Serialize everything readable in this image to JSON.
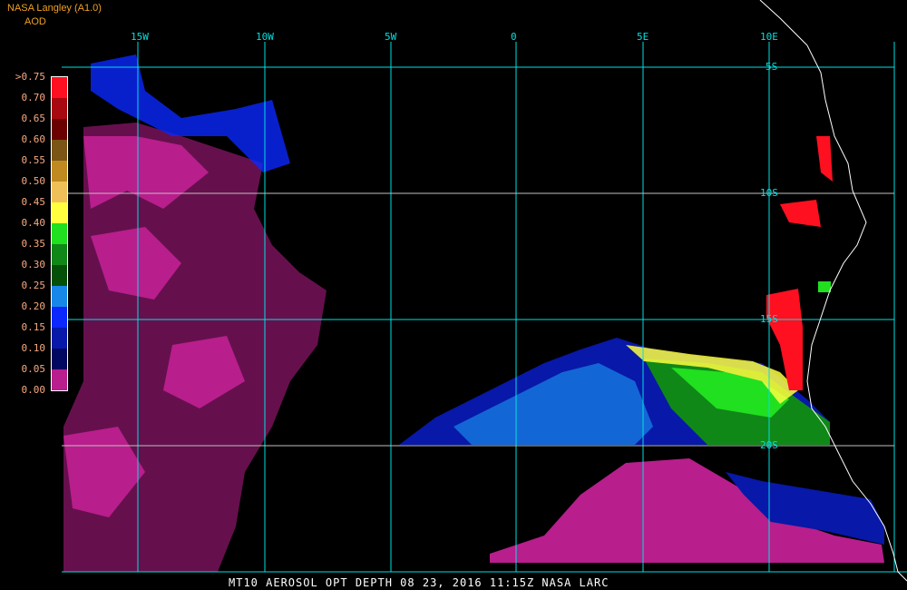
{
  "header": {
    "title": "NASA Langley (A1.0)",
    "units": "AOD"
  },
  "legend": {
    "labels": [
      ">0.75",
      "0.70",
      "0.65",
      "0.60",
      "0.55",
      "0.50",
      "0.45",
      "0.40",
      "0.35",
      "0.30",
      "0.25",
      "0.20",
      "0.15",
      "0.10",
      "0.05",
      "0.00"
    ],
    "colors": [
      "#ff1020",
      "#a80810",
      "#6a0000",
      "#7a5516",
      "#c08a20",
      "#f0c058",
      "#ffff40",
      "#20e020",
      "#108818",
      "#055008",
      "#1888e8",
      "#0a28ff",
      "#0818a8",
      "#000860",
      "#b81e8c"
    ]
  },
  "grid": {
    "longitudes": [
      "15W",
      "10W",
      "5W",
      "0",
      "5E",
      "10E"
    ],
    "latitudes": [
      "5S",
      "10S",
      "15S",
      "20S"
    ],
    "grid_color": "#00e0e0"
  },
  "footer": "MT10   AEROSOL OPT DEPTH   08 23, 2016 11:15Z   NASA LARC"
}
